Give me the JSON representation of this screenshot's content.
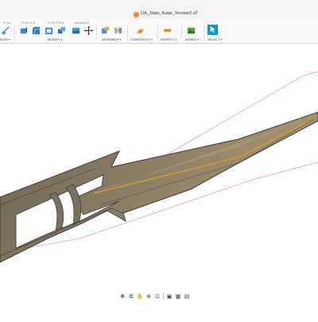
{
  "window": {
    "document_title": "OA_Stats_Katar_Version2 v2"
  },
  "ribbon": {
    "tabs": [
      "ETAL",
      "PLASTIC",
      "UTILITIES",
      "MANAGE"
    ],
    "groups": {
      "create": "EATE",
      "modify": "MODIFY",
      "assemble": "ASSEMBLE",
      "construct": "CONSTRUCT",
      "inspect": "INSPECT",
      "insert": "INSERT",
      "select": "SELECT"
    }
  },
  "icons": {
    "sketch": "sketch-icon",
    "press_pull": "press-pull-icon",
    "fillet": "fillet-icon",
    "shell": "shell-icon",
    "combine": "combine-icon",
    "move": "move-icon",
    "new_component": "new-component-icon",
    "joint": "joint-icon",
    "offset_plane": "offset-plane-icon",
    "measure": "measure-icon",
    "insert_image": "insert-image-icon",
    "select": "select-icon"
  },
  "colors": {
    "accent": "#0696d7",
    "model_fill": "#7a705f",
    "model_edge": "#3e3b36",
    "model_highlight": "#d99a32"
  },
  "navigation_bar": {
    "tools": [
      "orbit-icon",
      "look-at-icon",
      "pan-icon",
      "zoom-icon",
      "fit-icon",
      "display-settings-icon",
      "grid-icon",
      "viewports-icon"
    ]
  }
}
